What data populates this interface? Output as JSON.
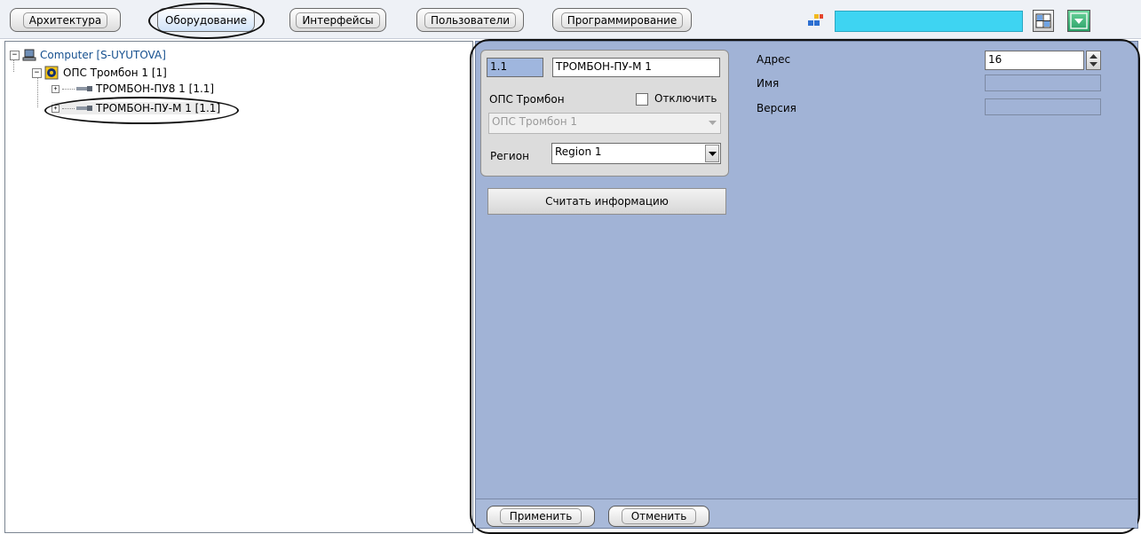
{
  "toolbar": {
    "tabs": [
      {
        "label": "Архитектура"
      },
      {
        "label": "Оборудование",
        "active": true
      },
      {
        "label": "Интерфейсы"
      },
      {
        "label": "Пользователи"
      },
      {
        "label": "Программирование"
      }
    ]
  },
  "tree": {
    "root": "Computer [S-UYUTOVA]",
    "child": "ОПС Тромбон 1 [1]",
    "items": [
      "ТРОМБОН-ПУ8 1 [1.1]",
      "ТРОМБОН-ПУ-М 1 [1.1]"
    ]
  },
  "settings": {
    "id_value": "1.1",
    "name_value": "ТРОМБОН-ПУ-М 1",
    "parent_label": "ОПС Тромбон",
    "disable_label": "Отключить",
    "parent_select_value": "ОПС Тромбон 1",
    "region_label": "Регион",
    "region_value": "Region 1",
    "read_info_button": "Считать информацию",
    "address_label": "Адрес",
    "address_value": "16",
    "name_label": "Имя",
    "name_info_value": "",
    "version_label": "Версия",
    "version_value": ""
  },
  "footer": {
    "apply_button": "Применить",
    "cancel_button": "Отменить"
  },
  "colors": {
    "panel": "#a1b3d6",
    "search_field": "#3ed4f2"
  }
}
